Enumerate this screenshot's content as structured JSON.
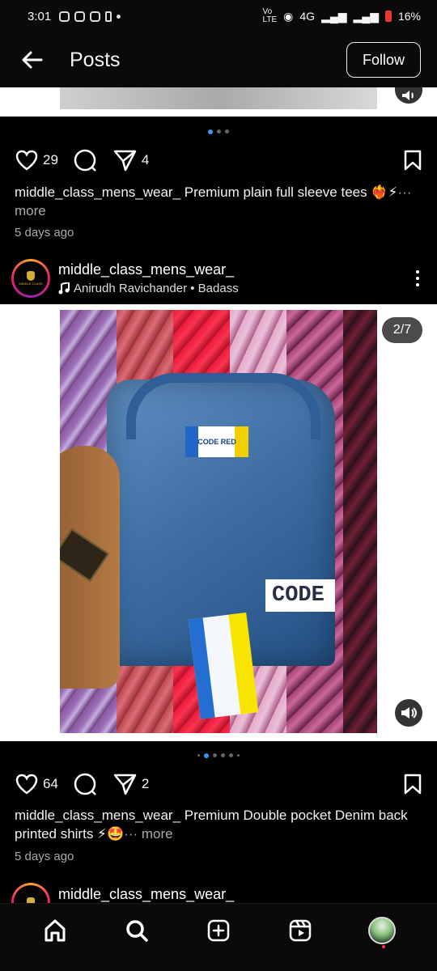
{
  "status_bar": {
    "time": "3:01",
    "network": "4G",
    "battery": "16%"
  },
  "header": {
    "title": "Posts",
    "follow_label": "Follow"
  },
  "posts": [
    {
      "likes": "29",
      "shares": "4",
      "caption_user": "middle_class_mens_wear_",
      "caption_text": "Premium plain  full sleeve tees ❤️‍🔥⚡",
      "more_label": "··· more",
      "timestamp": "5 days ago"
    },
    {
      "username": "middle_class_mens_wear_",
      "audio": "Anirudh Ravichander • Badass",
      "media_counter": "2/7",
      "likes": "64",
      "shares": "2",
      "caption_user": "middle_class_mens_wear_",
      "caption_text": "Premium Double pocket Denim back printed shirts ⚡🤩",
      "more_label": "··· more",
      "timestamp": "5 days ago"
    },
    {
      "username": "middle_class_mens_wear_"
    }
  ],
  "nav": {
    "items": [
      "home",
      "search",
      "create",
      "reels",
      "profile"
    ]
  },
  "icons": {
    "back": "back-arrow-icon",
    "like": "heart-icon",
    "comment": "comment-icon",
    "share": "share-icon",
    "save": "bookmark-icon",
    "sound": "speaker-icon",
    "menu": "more-vertical-icon"
  }
}
